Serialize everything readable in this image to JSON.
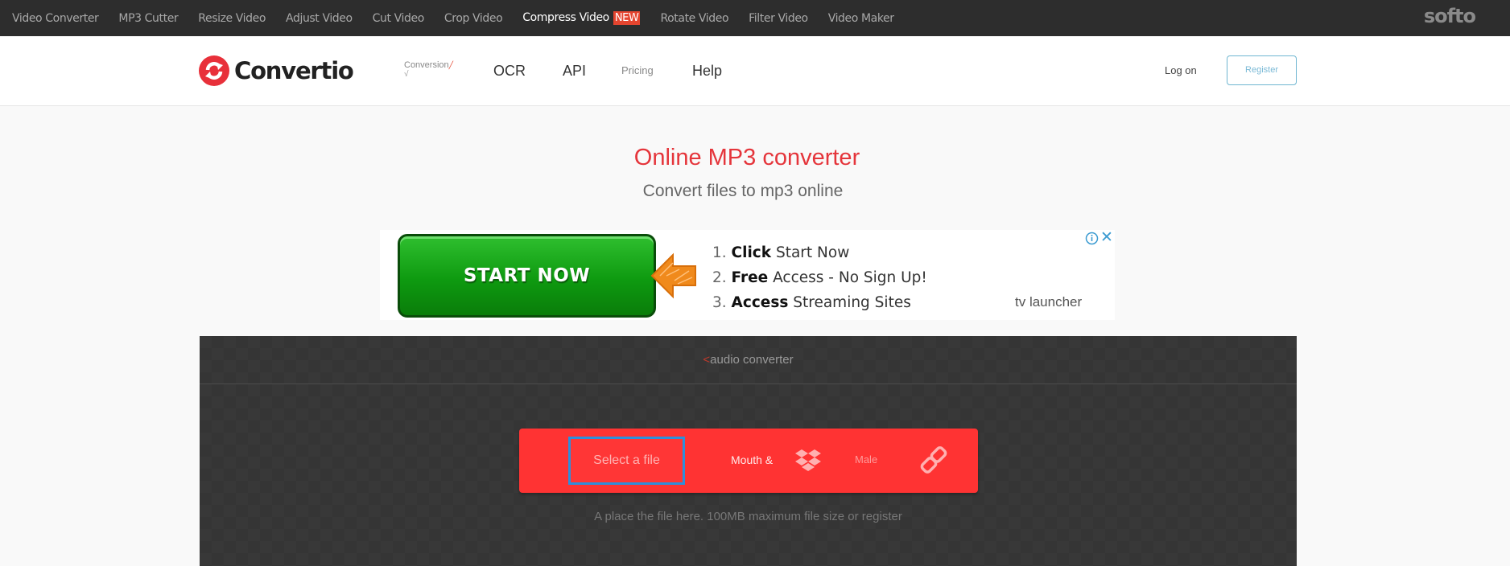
{
  "topbar": {
    "links": [
      {
        "label": "Video Converter"
      },
      {
        "label": "MP3 Cutter"
      },
      {
        "label": "Resize Video"
      },
      {
        "label": "Adjust Video"
      },
      {
        "label": "Cut Video"
      },
      {
        "label": "Crop Video"
      },
      {
        "label": "Compress Video",
        "badge": "NEW"
      },
      {
        "label": "Rotate Video"
      },
      {
        "label": "Filter Video"
      },
      {
        "label": "Video Maker"
      }
    ],
    "brand": "softo"
  },
  "header": {
    "logo_text": "Convertio",
    "logo_color": "#e8303a",
    "nav": {
      "conversion": "Conversion",
      "conversion_mark": "√",
      "ocr": "OCR",
      "api": "API",
      "pricing": "Pricing",
      "help": "Help"
    },
    "login": "Log on",
    "register": "Register"
  },
  "hero": {
    "title": "Online MP3 converter",
    "subtitle": "Convert files to mp3 online",
    "accent": "#e5353b"
  },
  "ad": {
    "button": "START NOW",
    "lines": [
      {
        "num": "1.",
        "bold": "Click",
        "rest": " Start Now"
      },
      {
        "num": "2.",
        "bold": "Free",
        "rest": " Access - No Sign Up!"
      },
      {
        "num": "3.",
        "bold": "Access",
        "rest": " Streaming Sites"
      }
    ],
    "brand": "tv launcher",
    "close": "✕"
  },
  "converter": {
    "heading_mark": "<",
    "heading": "audio converter",
    "select_file": "Select a file",
    "mouth": "Mouth &",
    "male": "Male",
    "drop_hint": "A place the file here. 100MB maximum file size or register",
    "bar_color": "#ff3333"
  }
}
